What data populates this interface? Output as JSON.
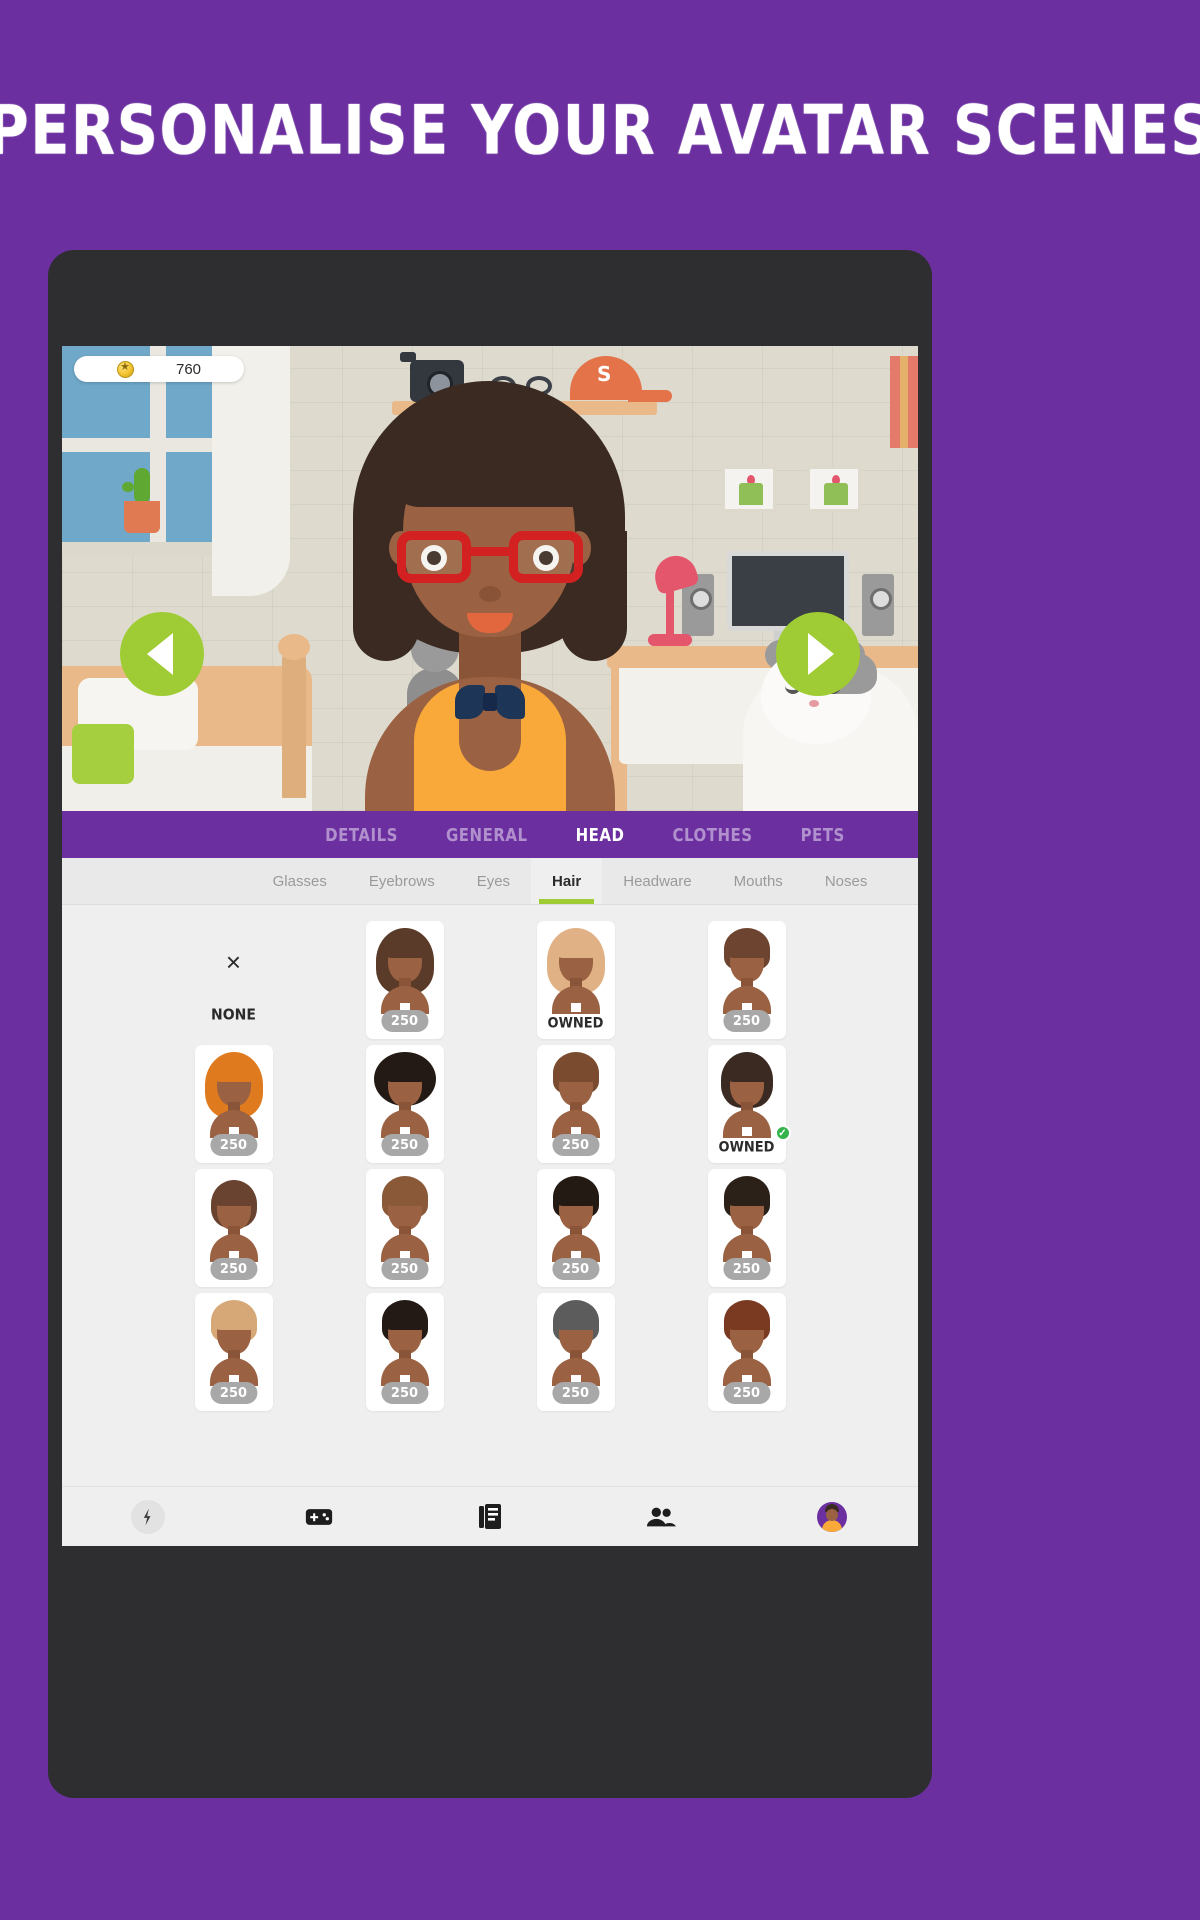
{
  "headline": "PERSONALISE YOUR AVATAR SCENES",
  "theme": {
    "background_purple": "#6B2FA0",
    "accent_green": "#9FCC34",
    "tab_bar_purple": "#6B2FA0",
    "price_badge_grey": "#A8A8A8",
    "check_green": "#34B34A"
  },
  "scene": {
    "coin_icon": "star-coin-icon",
    "coin_value": "760",
    "prev_arrow": "previous-scene-arrow",
    "next_arrow": "next-scene-arrow"
  },
  "category_tabs": [
    {
      "label": "DETAILS",
      "active": false
    },
    {
      "label": "GENERAL",
      "active": false
    },
    {
      "label": "HEAD",
      "active": true
    },
    {
      "label": "CLOTHES",
      "active": false
    },
    {
      "label": "PETS",
      "active": false
    }
  ],
  "sub_tabs": [
    {
      "label": "Glasses",
      "active": false
    },
    {
      "label": "Eyebrows",
      "active": false
    },
    {
      "label": "Eyes",
      "active": false
    },
    {
      "label": "Hair",
      "active": true
    },
    {
      "label": "Headware",
      "active": false
    },
    {
      "label": "Mouths",
      "active": false
    },
    {
      "label": "Noses",
      "active": false
    }
  ],
  "items": [
    {
      "id": "none",
      "type": "none",
      "label": "NONE",
      "icon": "close-x-icon"
    },
    {
      "id": "hair-1",
      "type": "item",
      "price": "250",
      "hair_color": "#5a3a28",
      "style": "long-straight"
    },
    {
      "id": "hair-2",
      "type": "item",
      "status": "OWNED",
      "hair_color": "#e0b184",
      "style": "long-wavy-blonde"
    },
    {
      "id": "hair-3",
      "type": "item",
      "price": "250",
      "hair_color": "#6d4430",
      "style": "short-crop"
    },
    {
      "id": "hair-4",
      "type": "item",
      "price": "250",
      "hair_color": "#e07a1e",
      "style": "long-ginger"
    },
    {
      "id": "hair-5",
      "type": "item",
      "price": "250",
      "hair_color": "#241a15",
      "style": "afro"
    },
    {
      "id": "hair-6",
      "type": "item",
      "price": "250",
      "hair_color": "#7a4b2e",
      "style": "pixie"
    },
    {
      "id": "hair-7",
      "type": "item",
      "status": "OWNED",
      "selected": true,
      "hair_color": "#3b2a22",
      "style": "bob-fringe",
      "check_icon": "check-circle-icon"
    },
    {
      "id": "hair-8",
      "type": "item",
      "price": "250",
      "hair_color": "#6a4230",
      "style": "bun"
    },
    {
      "id": "hair-9",
      "type": "item",
      "price": "250",
      "hair_color": "#8a5a38",
      "style": "buzz-light"
    },
    {
      "id": "hair-10",
      "type": "item",
      "price": "250",
      "hair_color": "#231a14",
      "style": "flat-top"
    },
    {
      "id": "hair-11",
      "type": "item",
      "price": "250",
      "hair_color": "#2c2119",
      "style": "short-dark"
    },
    {
      "id": "hair-12",
      "type": "item",
      "price": "250",
      "hair_color": "#d6a878",
      "style": "swoop-blonde"
    },
    {
      "id": "hair-13",
      "type": "item",
      "price": "250",
      "hair_color": "#241a15",
      "style": "short-black"
    },
    {
      "id": "hair-14",
      "type": "item",
      "price": "250",
      "hair_color": "#5c5c5c",
      "style": "grey-short"
    },
    {
      "id": "hair-15",
      "type": "item",
      "price": "250",
      "hair_color": "#7a3a22",
      "style": "auburn-short"
    }
  ],
  "bottom_nav": [
    {
      "id": "nav-timeline",
      "icon": "clock-lightning-icon"
    },
    {
      "id": "nav-games",
      "icon": "game-controller-icon"
    },
    {
      "id": "nav-feed",
      "icon": "news-feed-icon"
    },
    {
      "id": "nav-friends",
      "icon": "people-icon"
    },
    {
      "id": "nav-profile",
      "icon": "avatar-profile-icon"
    }
  ]
}
